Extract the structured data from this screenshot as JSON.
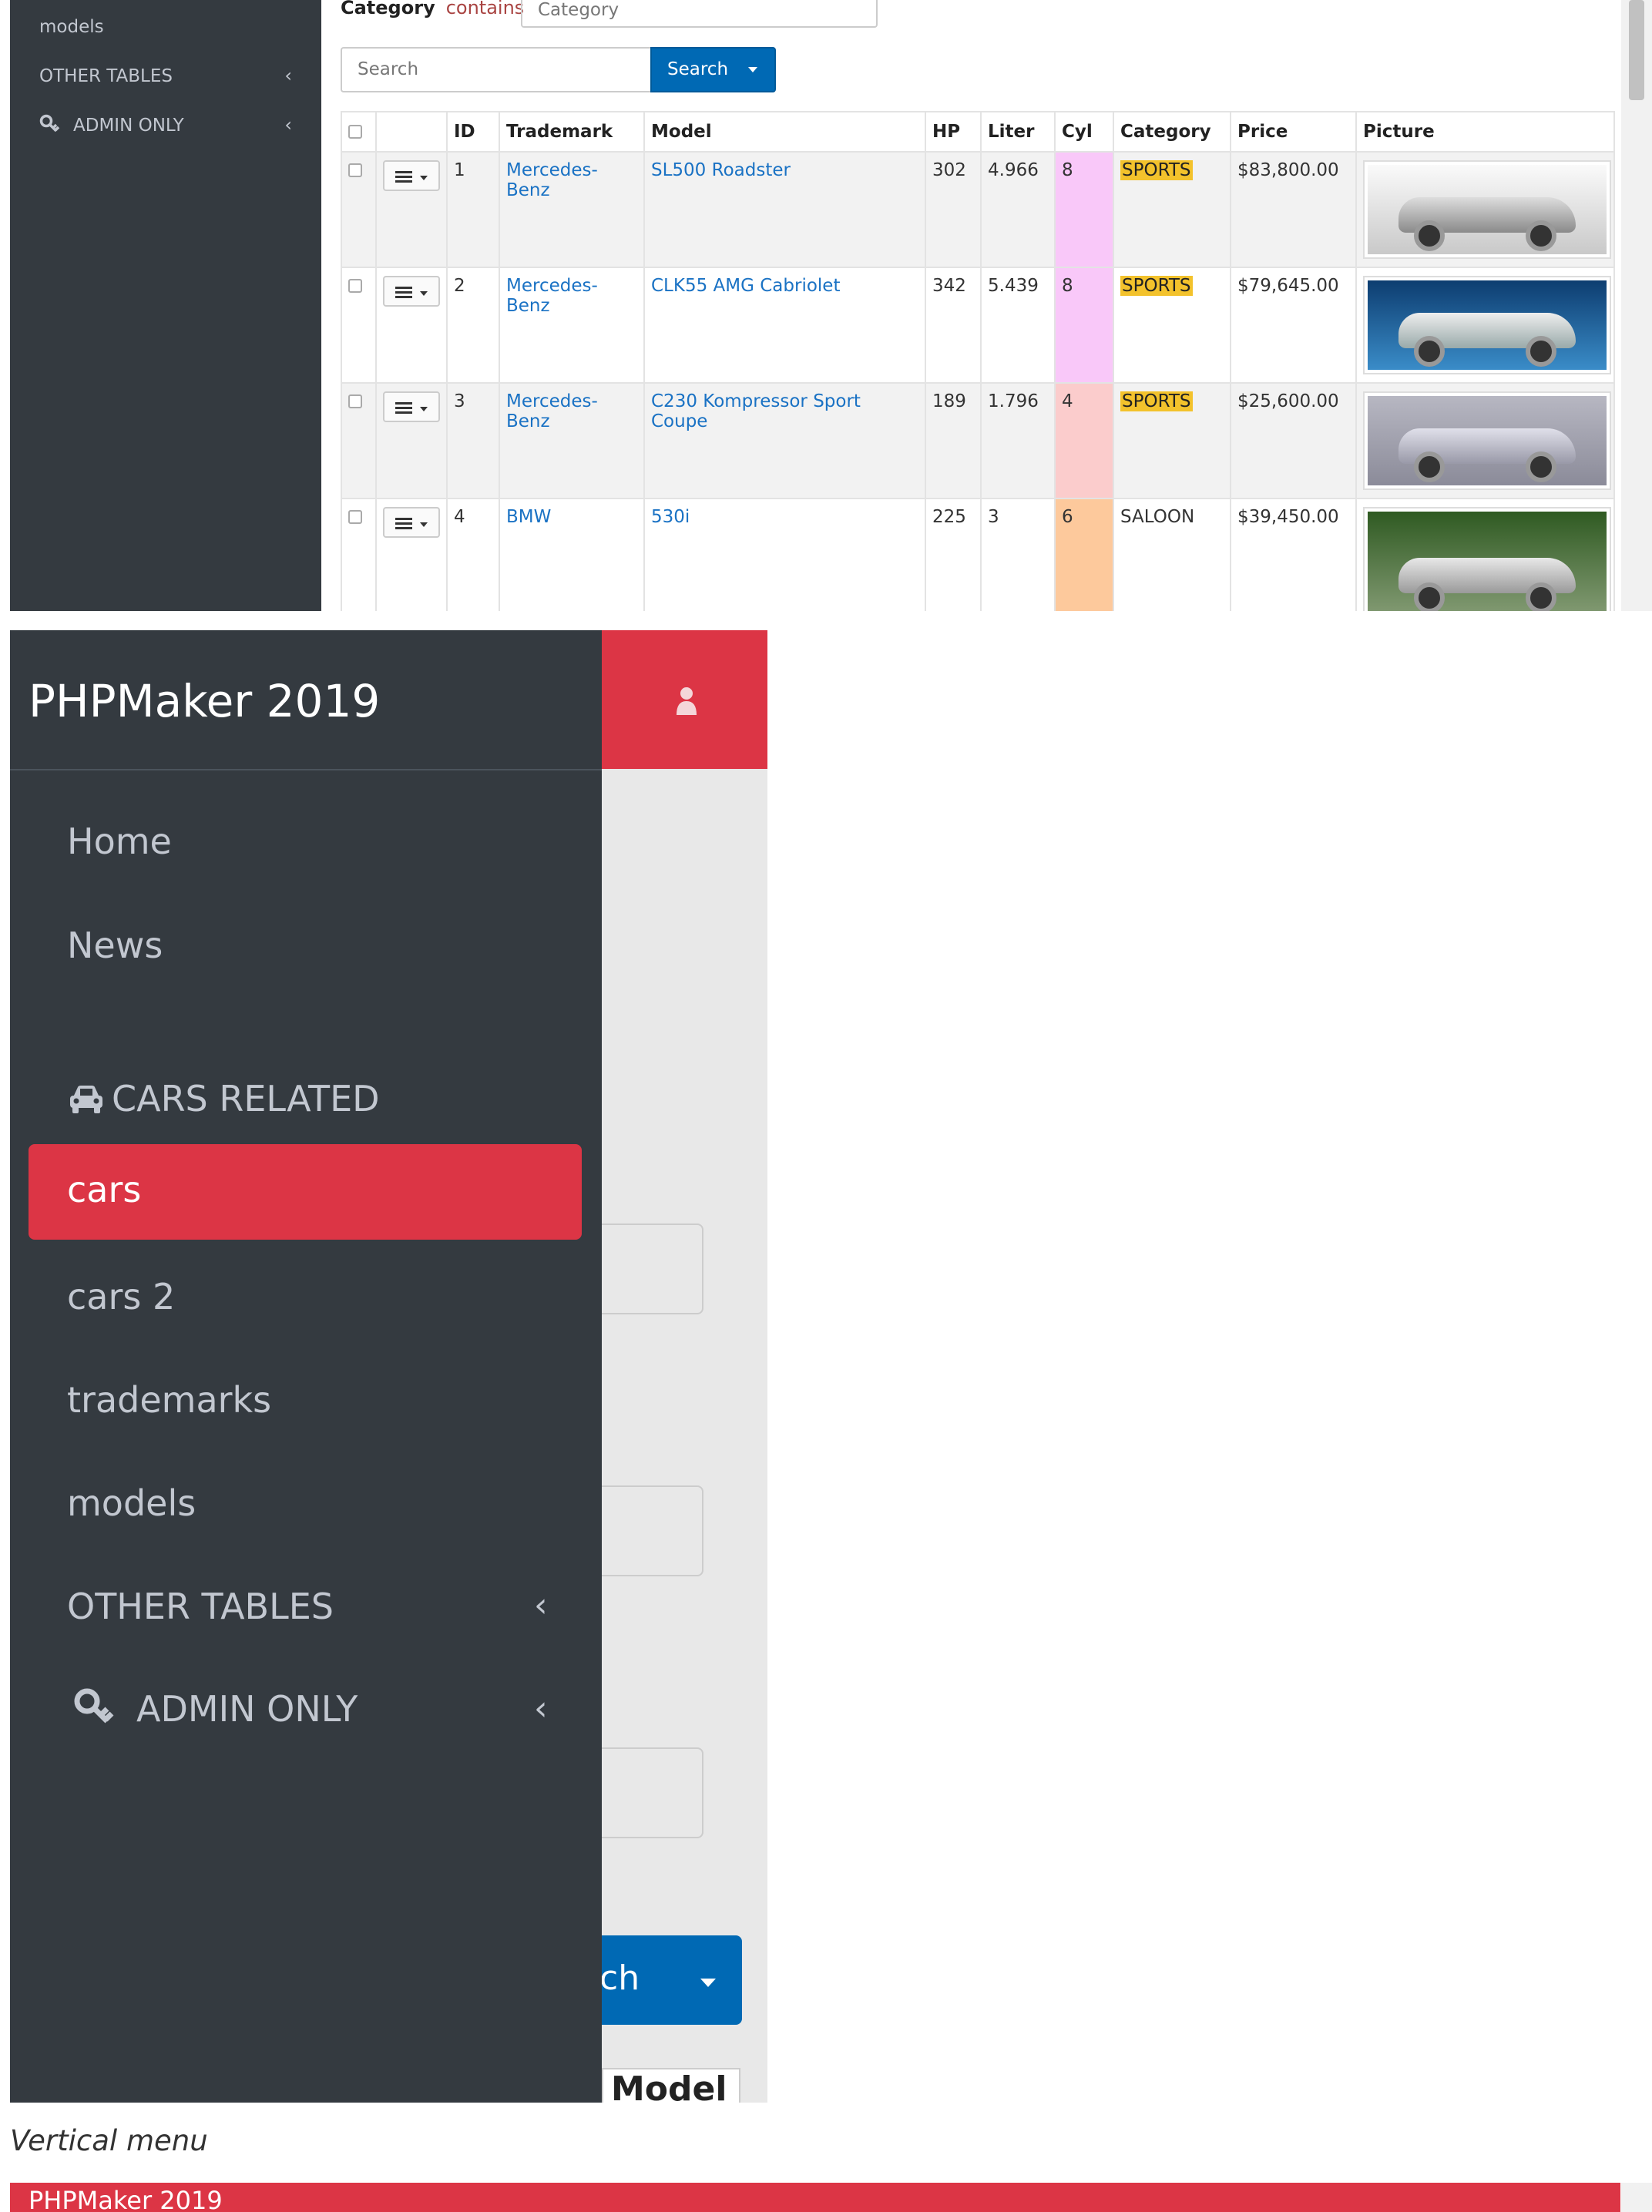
{
  "desktop": {
    "sidebar": {
      "items": [
        {
          "label": "models"
        },
        {
          "label": "OTHER TABLES"
        },
        {
          "label": "ADMIN ONLY"
        }
      ]
    },
    "filter": {
      "field": "Category",
      "operator": "contains",
      "input_placeholder": "Category"
    },
    "search": {
      "placeholder": "Search",
      "button_label": "Search"
    },
    "table": {
      "columns": [
        "ID",
        "Trademark",
        "Model",
        "HP",
        "Liter",
        "Cyl",
        "Category",
        "Price",
        "Picture"
      ],
      "rows": [
        {
          "id": "1",
          "trademark": "Mercedes-Benz",
          "model": "SL500 Roadster",
          "hp": "302",
          "liter": "4.966",
          "cyl": "8",
          "category": "SPORTS",
          "price": "$83,800.00"
        },
        {
          "id": "2",
          "trademark": "Mercedes-Benz",
          "model": "CLK55 AMG Cabriolet",
          "hp": "342",
          "liter": "5.439",
          "cyl": "8",
          "category": "SPORTS",
          "price": "$79,645.00"
        },
        {
          "id": "3",
          "trademark": "Mercedes-Benz",
          "model": "C230 Kompressor Sport Coupe",
          "hp": "189",
          "liter": "1.796",
          "cyl": "4",
          "category": "SPORTS",
          "price": "$25,600.00"
        },
        {
          "id": "4",
          "trademark": "BMW",
          "model": "530i",
          "hp": "225",
          "liter": "3",
          "cyl": "6",
          "category": "SALOON",
          "price": "$39,450.00"
        }
      ]
    },
    "colors": {
      "cyl_8": "#f9c8f9",
      "cyl_4": "#fbcccc",
      "cyl_6": "#fdc99c",
      "sports_badge": "#f3c22c",
      "link": "#1a72c4",
      "primary": "#0069b4"
    }
  },
  "mobile": {
    "brand": "PHPMaker 2019",
    "menu": {
      "home": "Home",
      "news": "News",
      "group_cars": "CARS RELATED",
      "cars": "cars",
      "cars2": "cars 2",
      "trademarks": "trademarks",
      "models": "models",
      "other_tables": "OTHER TABLES",
      "admin_only": "ADMIN ONLY"
    },
    "partial_button": "ch",
    "partial_header": "Model",
    "colors": {
      "sidebar_bg": "#343a40",
      "active_bg": "#dc3545",
      "header_red": "#dc3545"
    }
  },
  "caption": "Vertical menu",
  "bottom_bar": {
    "brand": "PHPMaker 2019"
  }
}
